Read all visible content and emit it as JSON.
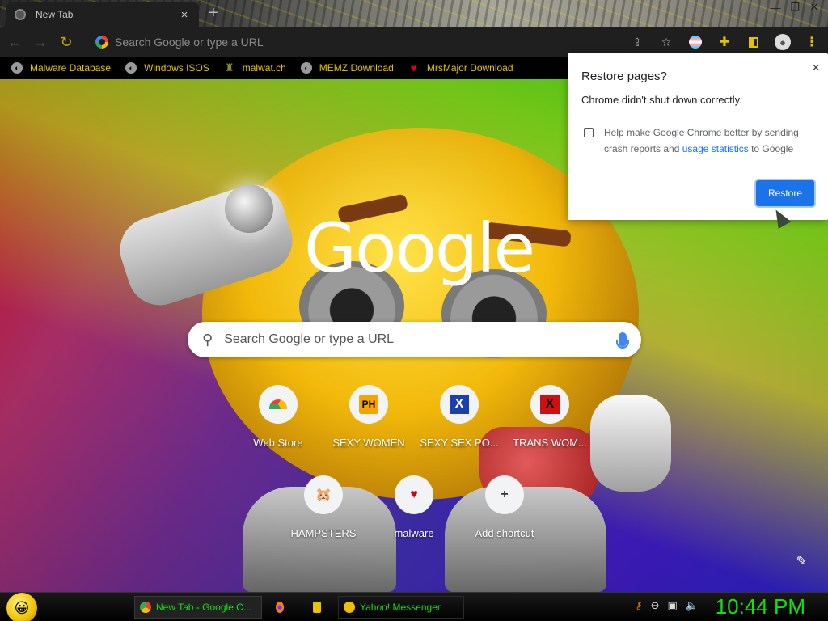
{
  "browser": {
    "tab": {
      "title": "New Tab",
      "close": "×"
    },
    "new_tab": "+",
    "window_controls": [
      "—",
      "❐",
      "✕"
    ],
    "omnibox": {
      "placeholder": "Search Google or type a URL"
    },
    "nav": {
      "back": "←",
      "forward": "→",
      "reload": "↻"
    }
  },
  "bookmarks": [
    {
      "label": "Malware Database",
      "icon": "globe-icon"
    },
    {
      "label": "Windows ISOS",
      "icon": "globe-icon"
    },
    {
      "label": "malwat.ch",
      "icon": "tower-icon"
    },
    {
      "label": "MEMZ Download",
      "icon": "globe-icon"
    },
    {
      "label": "MrsMajor Download",
      "icon": "heart-icon"
    }
  ],
  "new_tab_page": {
    "logo": "Google",
    "search_placeholder": "Search Google or type a URL",
    "shortcuts": [
      {
        "label": "Web Store",
        "icon": "webstore-icon"
      },
      {
        "label": "SEXY WOMEN",
        "icon": "ph-icon",
        "badge": "PH"
      },
      {
        "label": "SEXY SEX PO...",
        "icon": "x-icon",
        "badge": "X"
      },
      {
        "label": "TRANS WOM...",
        "icon": "x-icon",
        "badge": "X"
      },
      {
        "label": "HAMPSTERS",
        "icon": "hamster-icon"
      },
      {
        "label": "malware",
        "icon": "heart-icon"
      },
      {
        "label": "Add shortcut",
        "icon": "plus-icon"
      }
    ]
  },
  "restore_popup": {
    "title": "Restore pages?",
    "message": "Chrome didn't shut down correctly.",
    "checkbox_text_before": "Help make Google Chrome better by sending crash reports and ",
    "checkbox_link": "usage statistics",
    "checkbox_text_after": " to Google",
    "restore_button": "Restore",
    "close": "×",
    "checkbox_checked": false
  },
  "taskbar": {
    "tasks": [
      {
        "label": "New Tab - Google C...",
        "icon": "chrome-icon"
      },
      {
        "label": "",
        "icon": "firefox-icon"
      },
      {
        "label": "",
        "icon": "folder-icon"
      },
      {
        "label": "Yahoo! Messenger",
        "icon": "yahoo-messenger-icon"
      }
    ],
    "clock": "10:44 PM"
  },
  "colors": {
    "bookmark_text": "#e8c200",
    "accent_yellow": "#e0c400",
    "restore_button": "#1a73e8",
    "taskbar_text": "#14e014"
  }
}
